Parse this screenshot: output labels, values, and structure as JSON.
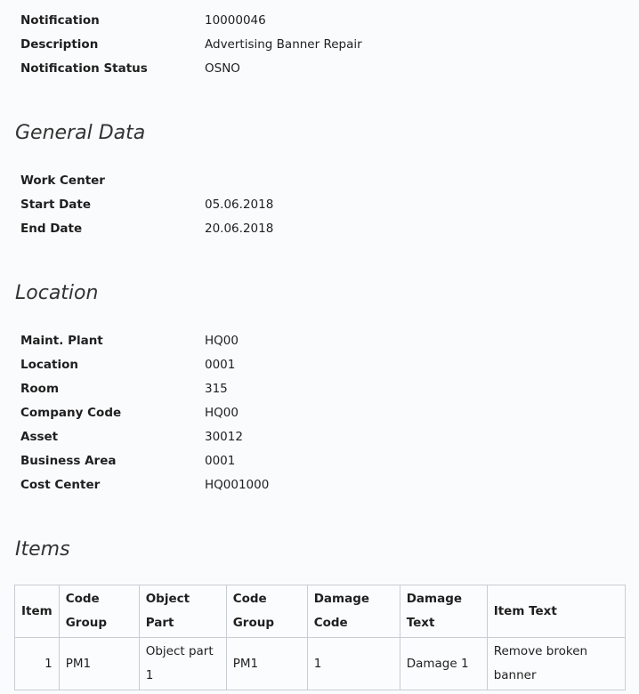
{
  "header": {
    "rows": [
      {
        "label": "Notification",
        "value": "10000046"
      },
      {
        "label": "Description",
        "value": "Advertising Banner Repair"
      },
      {
        "label": "Notification Status",
        "value": "OSNO"
      }
    ]
  },
  "general": {
    "title": "General Data",
    "rows": [
      {
        "label": "Work Center",
        "value": ""
      },
      {
        "label": "Start Date",
        "value": "05.06.2018"
      },
      {
        "label": "End Date",
        "value": "20.06.2018"
      }
    ]
  },
  "location": {
    "title": "Location",
    "rows": [
      {
        "label": "Maint. Plant",
        "value": "HQ00"
      },
      {
        "label": "Location",
        "value": "0001"
      },
      {
        "label": "Room",
        "value": "315"
      },
      {
        "label": "Company Code",
        "value": "HQ00"
      },
      {
        "label": "Asset",
        "value": "30012"
      },
      {
        "label": "Business Area",
        "value": "0001"
      },
      {
        "label": "Cost Center",
        "value": "HQ001000"
      }
    ]
  },
  "items": {
    "title": "Items",
    "headers": [
      "Item",
      "Code Group",
      "Object Part",
      "Code Group",
      "Damage Code",
      "Damage Text",
      "Item Text"
    ],
    "rows": [
      [
        "1",
        "PM1",
        "Object part 1",
        "PM1",
        "1",
        "Damage 1",
        "Remove broken banner"
      ]
    ]
  }
}
